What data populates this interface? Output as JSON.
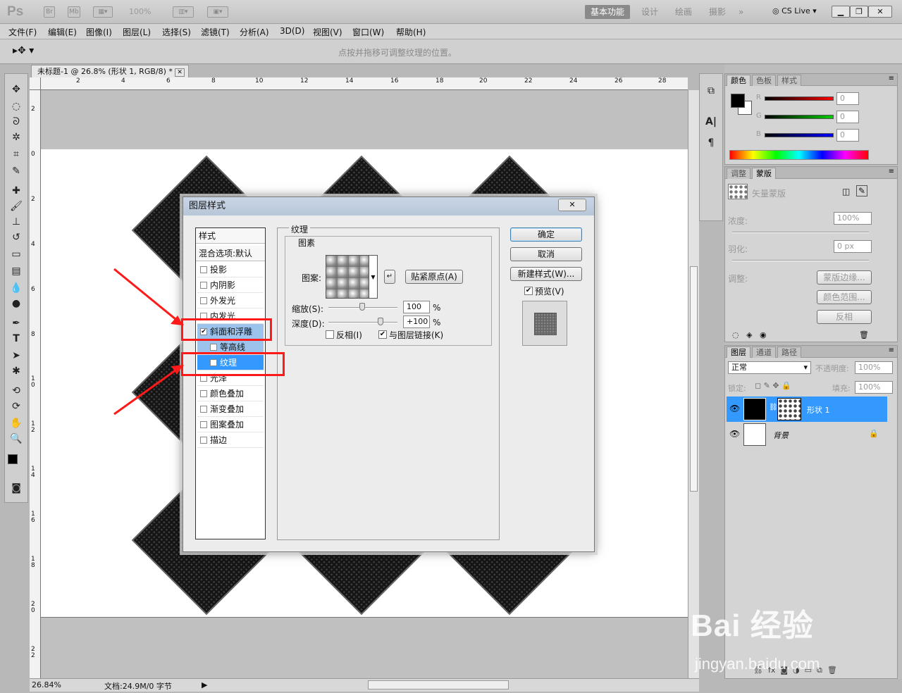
{
  "app": {
    "logo": "Ps",
    "br": "Br",
    "mb": "Mb",
    "zoom": "100%",
    "cslive": "CS Live"
  },
  "workspaces": [
    "基本功能",
    "设计",
    "绘画",
    "摄影",
    "»"
  ],
  "menu": [
    "文件(F)",
    "编辑(E)",
    "图像(I)",
    "图层(L)",
    "选择(S)",
    "滤镜(T)",
    "分析(A)",
    "3D(D)",
    "视图(V)",
    "窗口(W)",
    "帮助(H)"
  ],
  "options": {
    "hint": "点按并拖移可调整纹理的位置。"
  },
  "document": {
    "tab_title": "未标题-1 @ 26.8% (形状 1, RGB/8) *",
    "ruler_top": [
      "2",
      "4",
      "6",
      "8",
      "10",
      "12",
      "14",
      "16",
      "18",
      "20",
      "22",
      "24",
      "26",
      "28"
    ],
    "ruler_left": [
      "2",
      "0",
      "2",
      "4",
      "6",
      "8",
      "1\n0",
      "1\n2",
      "1\n4",
      "1\n6",
      "1\n8",
      "2\n0",
      "2\n2"
    ]
  },
  "status": {
    "zoom": "26.84%",
    "doc": "文档:24.9M/0 字节"
  },
  "dialog": {
    "title": "图层样式",
    "styles_header": "样式",
    "blend_header": "混合选项:默认",
    "styles": [
      {
        "label": "投影",
        "checked": false,
        "sub": false,
        "sel": 0
      },
      {
        "label": "内阴影",
        "checked": false,
        "sub": false,
        "sel": 0
      },
      {
        "label": "外发光",
        "checked": false,
        "sub": false,
        "sel": 0
      },
      {
        "label": "内发光",
        "checked": false,
        "sub": false,
        "sel": 0
      },
      {
        "label": "斜面和浮雕",
        "checked": true,
        "sub": false,
        "sel": 1
      },
      {
        "label": "等高线",
        "checked": false,
        "sub": true,
        "sel": 1
      },
      {
        "label": "纹理",
        "checked": true,
        "sub": true,
        "sel": 2
      },
      {
        "label": "光泽",
        "checked": false,
        "sub": false,
        "sel": 0
      },
      {
        "label": "颜色叠加",
        "checked": false,
        "sub": false,
        "sel": 0
      },
      {
        "label": "渐变叠加",
        "checked": false,
        "sub": false,
        "sel": 0
      },
      {
        "label": "图案叠加",
        "checked": false,
        "sub": false,
        "sel": 0
      },
      {
        "label": "描边",
        "checked": false,
        "sub": false,
        "sel": 0
      }
    ],
    "texture_title": "纹理",
    "pattern_group": "图素",
    "pattern_label": "图案:",
    "snap_button": "贴紧原点(A)",
    "scale_label": "缩放(S):",
    "scale_value": "100",
    "depth_label": "深度(D):",
    "depth_value": "+100",
    "percent": "%",
    "invert_label": "反相(I)",
    "invert_checked": false,
    "link_label": "与图层链接(K)",
    "link_checked": true,
    "ok": "确定",
    "cancel": "取消",
    "new_style": "新建样式(W)...",
    "preview_label": "预览(V)",
    "preview_checked": true
  },
  "color_panel": {
    "tabs": [
      "颜色",
      "色板",
      "样式"
    ],
    "channels": [
      {
        "name": "R",
        "value": "0",
        "color": "#ff0000"
      },
      {
        "name": "G",
        "value": "0",
        "color": "#00cc00"
      },
      {
        "name": "B",
        "value": "0",
        "color": "#0000ff"
      }
    ]
  },
  "mask_panel": {
    "tabs": [
      "调整",
      "蒙版"
    ],
    "kind": "矢量蒙版",
    "density_label": "浓度:",
    "density_value": "100%",
    "feather_label": "羽化:",
    "feather_value": "0 px",
    "adjust_label": "调整:",
    "mask_edge": "蒙版边缘...",
    "color_range": "颜色范围...",
    "invert": "反相"
  },
  "layers_panel": {
    "tabs": [
      "图层",
      "通道",
      "路径"
    ],
    "blend_mode": "正常",
    "opacity_label": "不透明度:",
    "opacity_value": "100%",
    "lock_label": "锁定:",
    "fill_label": "填充:",
    "fill_value": "100%",
    "layers": [
      {
        "name": "形状 1",
        "selected": true
      },
      {
        "name": "背景",
        "selected": false
      }
    ]
  },
  "watermark": {
    "brand": "Bai 经验",
    "url": "jingyan.baidu.com"
  }
}
